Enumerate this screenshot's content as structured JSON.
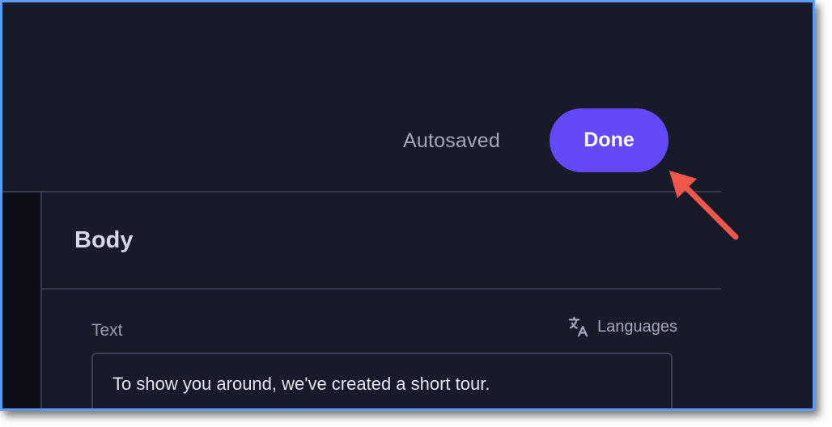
{
  "header": {
    "status_text": "Autosaved",
    "done_label": "Done",
    "done_color": "#6548f8"
  },
  "section": {
    "title": "Body"
  },
  "field": {
    "label": "Text",
    "languages_label": "Languages",
    "languages_icon": "translate-icon",
    "value": "To show you around, we've created a short tour."
  },
  "annotation": {
    "arrow_color": "#f0574a",
    "arrow_icon": "arrow-pointer-icon"
  }
}
